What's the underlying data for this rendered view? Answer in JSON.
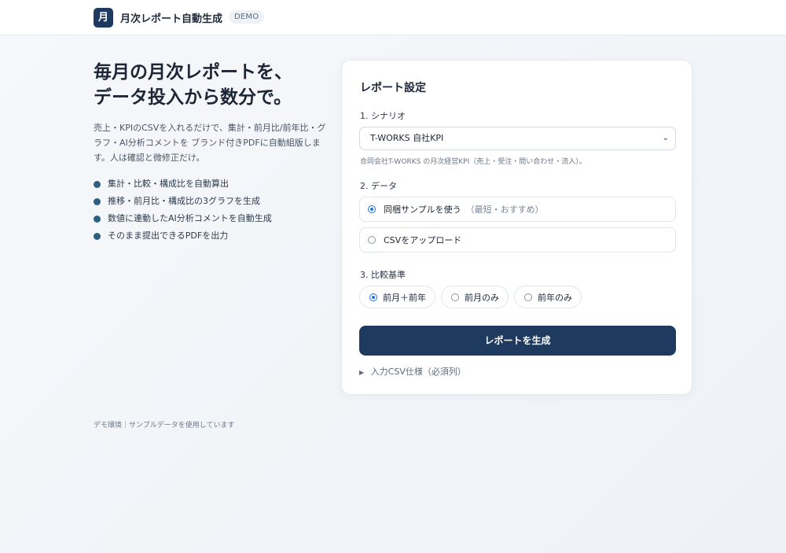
{
  "header": {
    "logo_char": "月",
    "app_title": "月次レポート自動生成",
    "badge": "DEMO"
  },
  "hero": {
    "title_line1": "毎月の月次レポートを、",
    "title_line2": "データ投入から数分で。",
    "description": "売上・KPIのCSVを入れるだけで、集計・前月比/前年比・グラフ・AI分析コメントを ブランド付きPDFに自動組版します。人は確認と微修正だけ。",
    "features": [
      "集計・比較・構成比を自動算出",
      "推移・前月比・構成比の3グラフを生成",
      "数値に連動したAI分析コメントを自動生成",
      "そのまま提出できるPDFを出力"
    ]
  },
  "footer": {
    "note": "デモ環境｜サンプルデータを使用しています"
  },
  "form": {
    "title": "レポート設定",
    "scenario": {
      "label": "1. シナリオ",
      "selected": "T-WORKS 自社KPI",
      "hint": "合同会社T-WORKS の月次経営KPI（売上・受注・問い合わせ・流入）。"
    },
    "data": {
      "label": "2. データ",
      "options": [
        {
          "label": "同梱サンプルを使う",
          "sub": "（最短・おすすめ）",
          "checked": true
        },
        {
          "label": "CSVをアップロード",
          "sub": "",
          "checked": false
        }
      ]
    },
    "compare": {
      "label": "3. 比較基準",
      "options": [
        {
          "label": "前月＋前年",
          "checked": true
        },
        {
          "label": "前月のみ",
          "checked": false
        },
        {
          "label": "前年のみ",
          "checked": false
        }
      ]
    },
    "generate_label": "レポートを生成",
    "csv_spec_label": "入力CSV仕様（必須列）"
  },
  "colors": {
    "brand": "#1e3a5f",
    "accent_radio": "#1a73e8",
    "feature_dot": "#2f5f7f"
  }
}
